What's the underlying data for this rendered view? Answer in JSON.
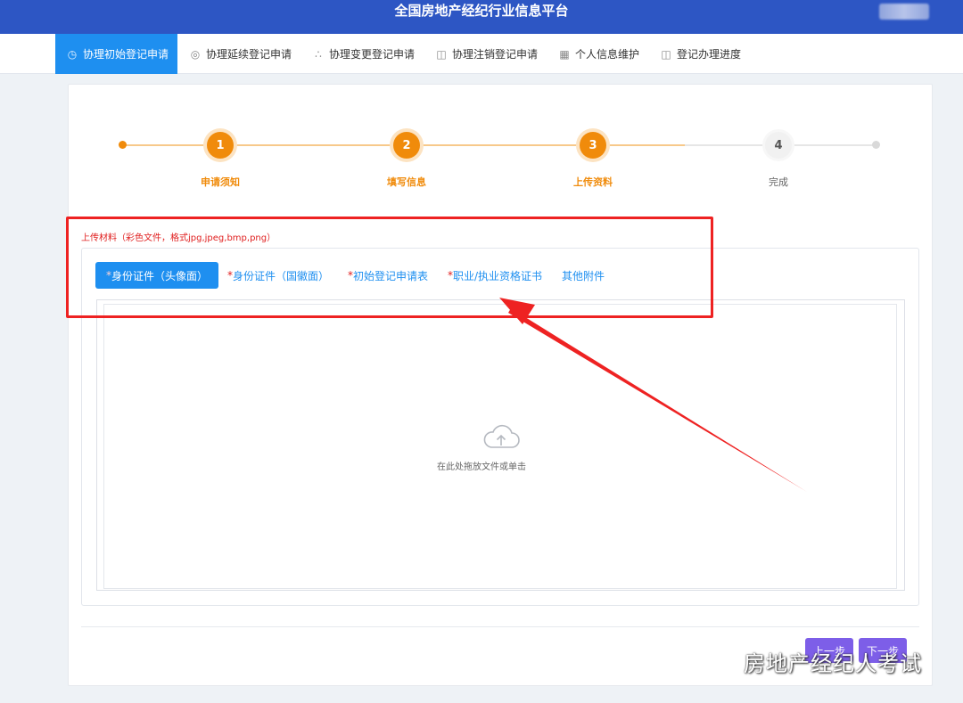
{
  "header": {
    "title": "全国房地产经纪行业信息平台"
  },
  "nav": {
    "items": [
      {
        "label": "协理初始登记申请",
        "icon": "clock-icon",
        "active": true
      },
      {
        "label": "协理延续登记申请",
        "icon": "target-icon"
      },
      {
        "label": "协理变更登记申请",
        "icon": "bubbles-icon"
      },
      {
        "label": "协理注销登记申请",
        "icon": "book-icon"
      },
      {
        "label": "个人信息维护",
        "icon": "grid-icon"
      },
      {
        "label": "登记办理进度",
        "icon": "book-icon"
      }
    ]
  },
  "steps": [
    {
      "number": "1",
      "label": "申请须知",
      "status": "done"
    },
    {
      "number": "2",
      "label": "填写信息",
      "status": "done"
    },
    {
      "number": "3",
      "label": "上传资料",
      "status": "done"
    },
    {
      "number": "4",
      "label": "完成",
      "status": "todo"
    }
  ],
  "upload": {
    "title": "上传材料（彩色文件，格式jpg,jpeg,bmp,png）",
    "tabs": [
      {
        "required_mark": "*",
        "label": "身份证件（头像面）",
        "active": true
      },
      {
        "required_mark": "*",
        "label": "身份证件（国徽面）"
      },
      {
        "required_mark": "*",
        "label": "初始登记申请表"
      },
      {
        "required_mark": "*",
        "label": "职业/执业资格证书"
      },
      {
        "required_mark": "",
        "label": "其他附件"
      }
    ],
    "drop_text": "在此处拖放文件或单击",
    "drop_icon": "cloud-upload-icon"
  },
  "buttons": {
    "prev": "上一步",
    "next": "下一步"
  },
  "watermark": {
    "text": "房地产经纪人考试",
    "icon": "wechat-icon"
  },
  "colors": {
    "header_bg": "#2d56c4",
    "active_blue": "#1e8ff0",
    "step_orange": "#f08b0b",
    "required_red": "#e02020",
    "annotation_red": "#ee2222",
    "button_purple": "#7d5ee8"
  }
}
